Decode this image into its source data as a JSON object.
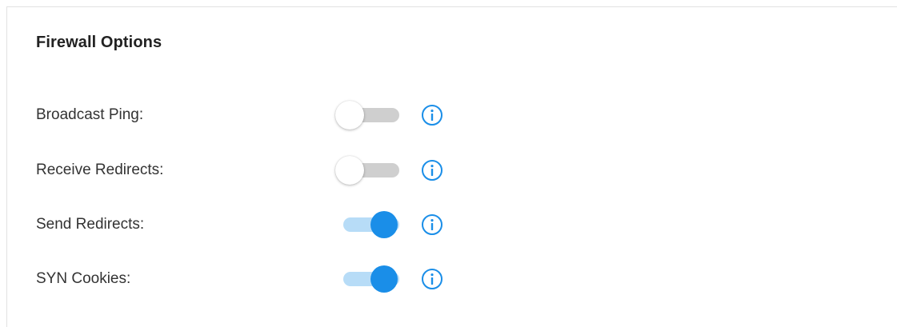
{
  "section": {
    "title": "Firewall Options"
  },
  "options": [
    {
      "label": "Broadcast Ping:",
      "enabled": false,
      "info_icon": "info-circle-icon"
    },
    {
      "label": "Receive Redirects:",
      "enabled": false,
      "info_icon": "info-circle-icon"
    },
    {
      "label": "Send Redirects:",
      "enabled": true,
      "info_icon": "info-circle-icon"
    },
    {
      "label": "SYN Cookies:",
      "enabled": true,
      "info_icon": "info-circle-icon"
    }
  ],
  "colors": {
    "toggle_on_thumb": "#1a8ee8",
    "toggle_on_track": "#b7dcf7",
    "toggle_off_track": "#cfcfcf",
    "info_icon": "#1a8ee8"
  }
}
